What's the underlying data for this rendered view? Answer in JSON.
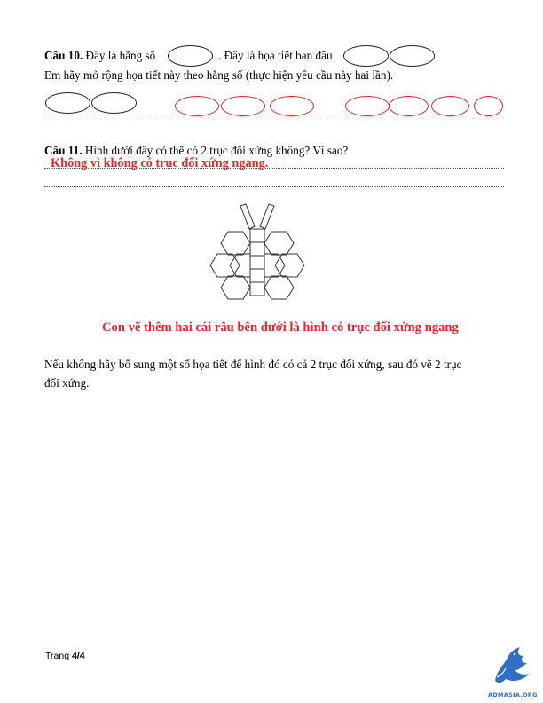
{
  "q10": {
    "label": "Câu 10.",
    "text_a": " Đây là hằng số",
    "text_b": ". Đây là họa tiết ban đầu",
    "line2": "Em hãy mở rộng họa tiết này theo hằng số (thực hiện yêu cầu này hai lần)."
  },
  "q11": {
    "label": "Câu 11.",
    "text": " Hình dưới đây có thể có 2 trục đối xứng không? Vì sao?",
    "answer": "Không vì không có trục đối xứng ngang.",
    "note": "Con vẽ thêm hai cái râu bên dưới là hình có trục đối xứng ngang",
    "follow_line1": "Nếu không hãy bổ sung một số họa tiết để hình đó có cả 2 trục đối xứng, sau đó vẽ 2 trục",
    "follow_line2": "đối xứng."
  },
  "footer": {
    "page_prefix": "Trang ",
    "page_num": "4/4",
    "logo_text": "ADMASIA.ORG"
  },
  "colors": {
    "answer_red": "#e8262d",
    "outline": "#222222"
  }
}
